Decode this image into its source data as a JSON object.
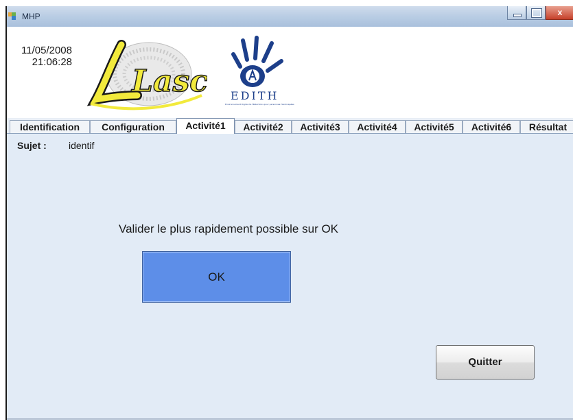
{
  "window": {
    "title": "MHP",
    "controls": {
      "minimize": "minimize",
      "maximize": "maximize",
      "close": "x"
    }
  },
  "header": {
    "date": "11/05/2008",
    "time": "21:06:28",
    "logo_lasc_text": "Lasc",
    "logo_edith_text": "EDITH",
    "logo_edith_tagline": "Environnement Digital de Téléactions pour personnes Handicapées"
  },
  "tabs": [
    {
      "label": "Identification",
      "active": false
    },
    {
      "label": "Configuration",
      "active": false
    },
    {
      "label": "Activité1",
      "active": true
    },
    {
      "label": "Activité2",
      "active": false
    },
    {
      "label": "Activité3",
      "active": false
    },
    {
      "label": "Activité4",
      "active": false
    },
    {
      "label": "Activité5",
      "active": false
    },
    {
      "label": "Activité6",
      "active": false
    },
    {
      "label": "Résultat",
      "active": false
    }
  ],
  "panel": {
    "subject_label": "Sujet :",
    "subject_value": "identif",
    "instruction": "Valider le plus rapidement possible sur OK",
    "ok_label": "OK",
    "quit_label": "Quitter"
  },
  "colors": {
    "ok_button": "#5d8ee8",
    "panel_background": "#e2ebf6",
    "lasc_yellow": "#f2ea3c",
    "edith_blue": "#1d3f8a"
  }
}
